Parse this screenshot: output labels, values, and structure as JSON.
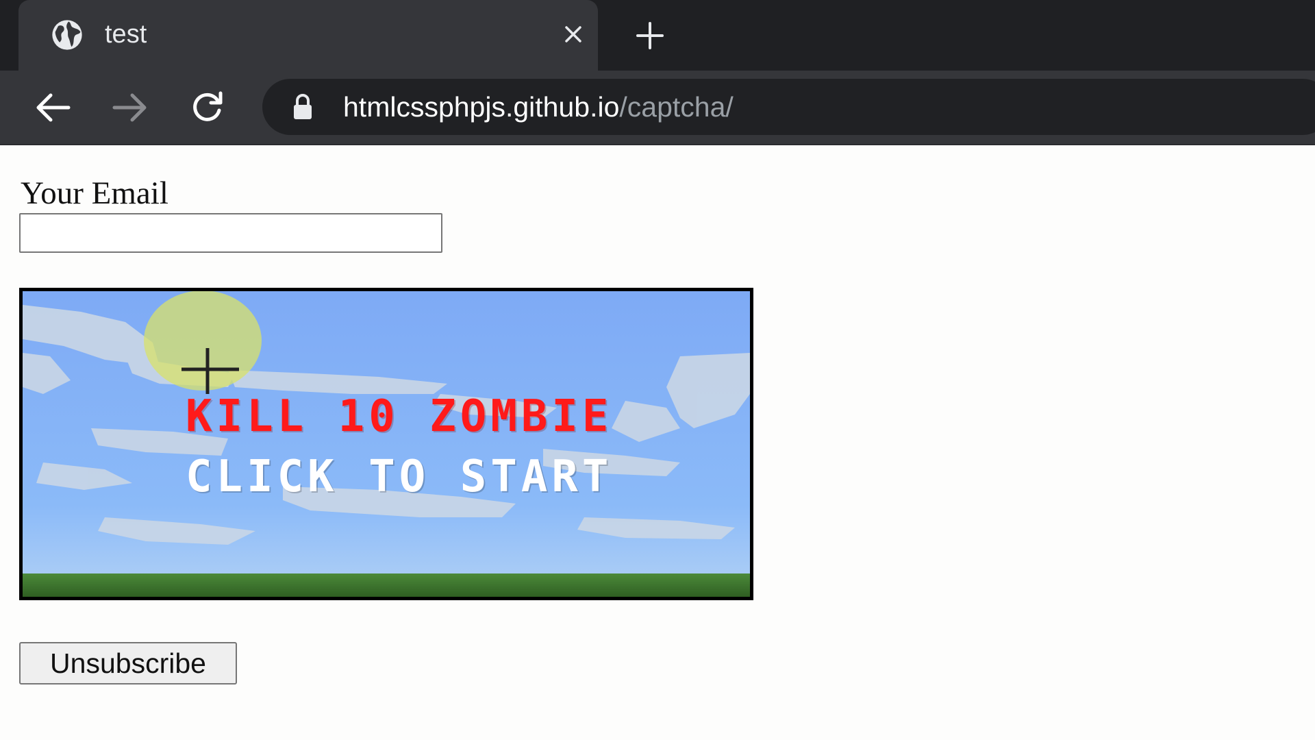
{
  "browser": {
    "tab": {
      "title": "test",
      "icon": "globe-icon"
    },
    "address": {
      "host": "htmlcssphpjs.github.io",
      "path": "/captcha/"
    }
  },
  "form": {
    "email_label": "Your Email",
    "email_value": "",
    "submit_label": "Unsubscribe"
  },
  "captcha": {
    "title": "KILL 10 ZOMBIE",
    "subtitle": "CLICK TO START"
  },
  "colors": {
    "chrome_dark": "#1f2023",
    "chrome_tab": "#35363a",
    "omnibox": "#202124",
    "captcha_title": "#ff1a1a",
    "sky": "#7aaeff",
    "grass": "#3f7a2c"
  }
}
